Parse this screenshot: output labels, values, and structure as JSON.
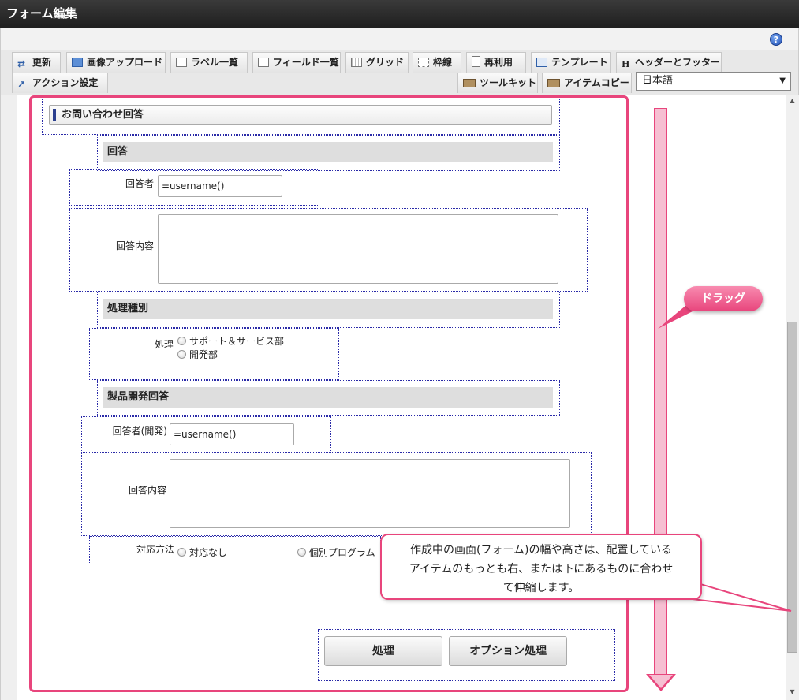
{
  "window": {
    "title": "フォーム編集"
  },
  "toolbar": {
    "tabs_row1": [
      {
        "label": "更新",
        "icon": "update-icon"
      },
      {
        "label": "画像アップロード",
        "icon": "image-upload-icon"
      },
      {
        "label": "ラベル一覧",
        "icon": "label-list-icon"
      },
      {
        "label": "フィールド一覧",
        "icon": "field-list-icon"
      },
      {
        "label": "グリッド",
        "icon": "grid-icon"
      },
      {
        "label": "枠線",
        "icon": "border-icon"
      },
      {
        "label": "再利用",
        "icon": "reuse-icon"
      },
      {
        "label": "テンプレート",
        "icon": "template-icon"
      },
      {
        "label": "ヘッダーとフッター",
        "icon": "header-footer-icon"
      }
    ],
    "tabs_row2": [
      {
        "label": "アクション設定",
        "icon": "action-icon"
      },
      {
        "label": "ツールキット",
        "icon": "toolkit-icon"
      },
      {
        "label": "アイテムコピー",
        "icon": "item-copy-icon"
      }
    ],
    "language": "日本語"
  },
  "form": {
    "title": "お問い合わせ回答",
    "sections": {
      "answer": "回答",
      "process_type": "処理種別",
      "product_dev": "製品開発回答"
    },
    "fields": {
      "respondent_label": "回答者",
      "respondent_value": "=username()",
      "answer_content_label": "回答内容",
      "process_label": "処理",
      "process_options": [
        "サポート＆サービス部",
        "開発部"
      ],
      "dev_respondent_label": "回答者(開発)",
      "dev_respondent_value": "=username()",
      "dev_answer_content_label": "回答内容",
      "method_label": "対応方法",
      "method_options": [
        "対応なし",
        "個別プログラム"
      ]
    },
    "buttons": {
      "process": "処理",
      "option_process": "オプション処理"
    }
  },
  "annotations": {
    "drag": "ドラッグ",
    "callout_line1": "作成中の画面(フォーム)の幅や高さは、配置している",
    "callout_line2": "アイテムのもっとも右、または下にあるものに合わせ",
    "callout_line3": "て伸縮します。"
  },
  "colors": {
    "accent": "#e8457c",
    "guide": "#2a2aa8"
  }
}
